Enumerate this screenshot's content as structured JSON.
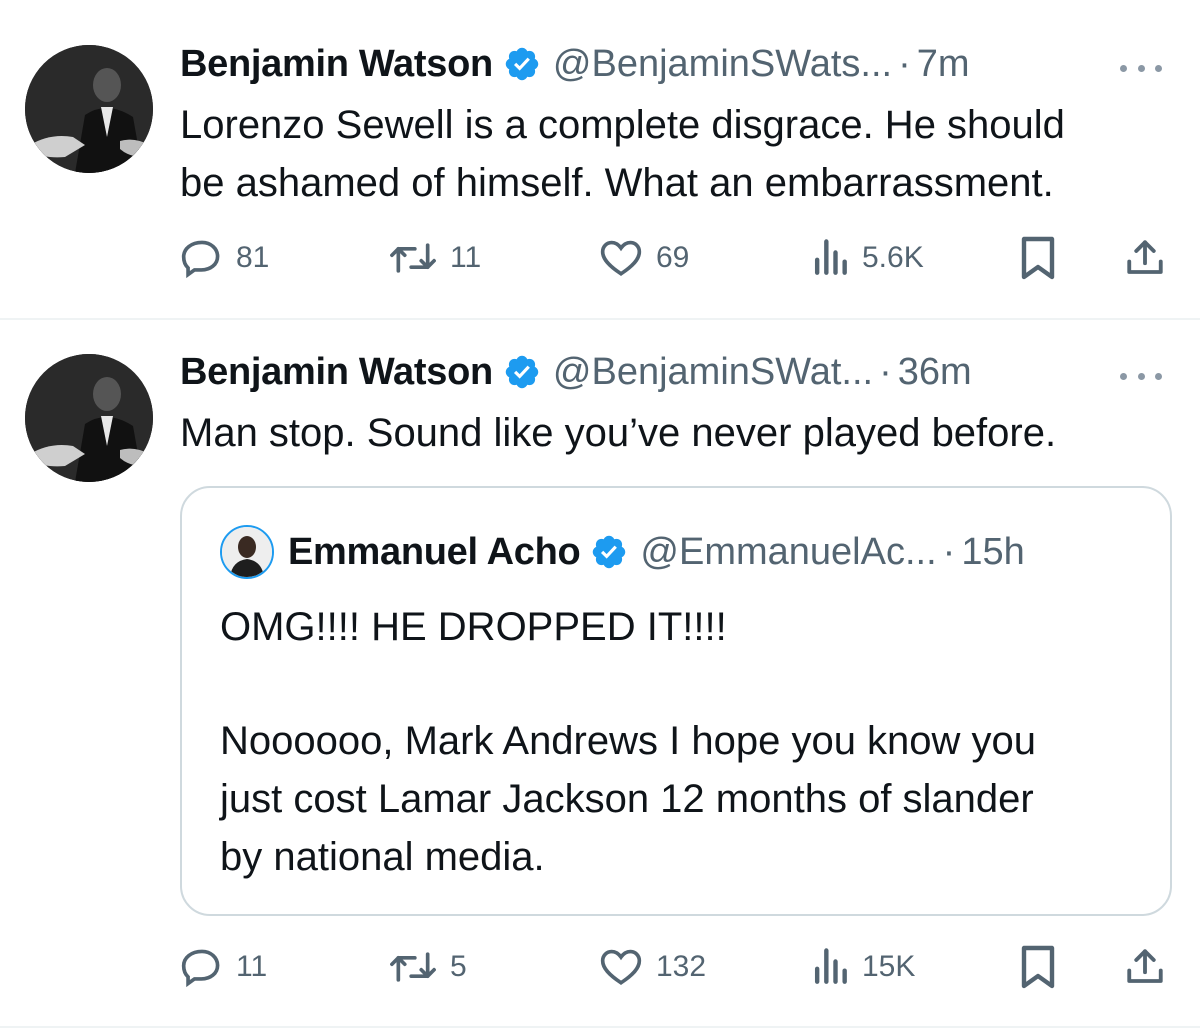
{
  "colors": {
    "verified": "#1d9bf0",
    "secondary_text": "#536471",
    "border": "#cfd9de"
  },
  "tweets": [
    {
      "author_name": "Benjamin Watson",
      "handle": "@BenjaminSWats...",
      "separator": "·",
      "time": "7m",
      "text_lines": [
        "Lorenzo Sewell is a complete disgrace. He should",
        "be ashamed of himself. What an embarrassment."
      ],
      "replies": "81",
      "reposts": "11",
      "likes": "69",
      "views": "5.6K"
    },
    {
      "author_name": "Benjamin Watson",
      "handle": "@BenjaminSWat...",
      "separator": "·",
      "time": "36m",
      "text_lines": [
        "Man stop. Sound like you’ve never played before."
      ],
      "quoted": {
        "author_name": "Emmanuel Acho",
        "handle": "@EmmanuelAc...",
        "separator": "·",
        "time": "15h",
        "line1": "OMG!!!! HE DROPPED IT!!!!",
        "lines": [
          "Noooooo, Mark Andrews I hope you know you",
          "just cost Lamar Jackson 12 months of slander",
          "by national media."
        ]
      },
      "replies": "11",
      "reposts": "5",
      "likes": "132",
      "views": "15K"
    }
  ],
  "icons": [
    "reply-icon",
    "repost-icon",
    "like-icon",
    "views-icon",
    "bookmark-icon",
    "share-icon",
    "verified-badge-icon",
    "more-options-icon"
  ]
}
